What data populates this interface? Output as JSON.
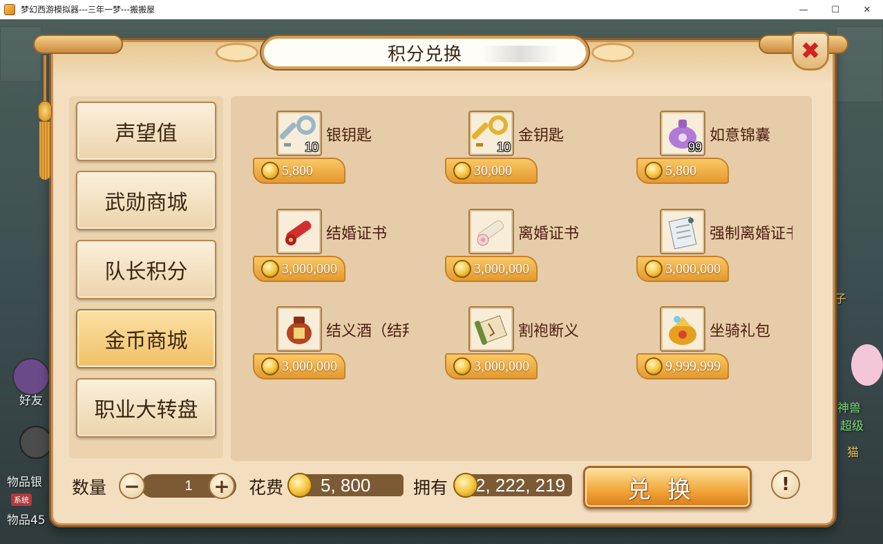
{
  "window": {
    "title": "梦幻西游模拟器---三年一梦---搬搬屋",
    "minimize": "—",
    "maximize": "☐",
    "close": "✕"
  },
  "background": {
    "left_texts": [
      "好友",
      "物品银",
      "物品45",
      "系统"
    ],
    "right_texts": [
      "子",
      "神兽",
      "超级",
      "猫"
    ]
  },
  "dialog": {
    "title": "积分兑换",
    "close_symbol": "✖"
  },
  "menu": {
    "items": [
      {
        "label": "声望值",
        "active": false
      },
      {
        "label": "武勋商城",
        "active": false
      },
      {
        "label": "队长积分",
        "active": false
      },
      {
        "label": "金币商城",
        "active": true
      },
      {
        "label": "职业大转盘",
        "active": false
      }
    ]
  },
  "items": [
    {
      "name": "银钥匙",
      "count": "10",
      "price": "5,800",
      "icon": "silver-key-icon"
    },
    {
      "name": "金钥匙",
      "count": "10",
      "price": "30,000",
      "icon": "gold-key-icon"
    },
    {
      "name": "如意锦囊",
      "count": "99",
      "price": "5,800",
      "icon": "brocade-pouch-icon"
    },
    {
      "name": "结婚证书",
      "count": "",
      "price": "3,000,000",
      "icon": "marriage-scroll-icon"
    },
    {
      "name": "离婚证书",
      "count": "",
      "price": "3,000,000",
      "icon": "divorce-scroll-icon"
    },
    {
      "name": "强制离婚证书",
      "count": "",
      "price": "3,000,000",
      "icon": "forced-divorce-paper-icon"
    },
    {
      "name": "结义酒（结拜）",
      "count": "",
      "price": "3,000,000",
      "icon": "wine-jar-icon"
    },
    {
      "name": "割袍断义",
      "count": "",
      "price": "3,000,000",
      "icon": "torn-scroll-icon"
    },
    {
      "name": "坐骑礼包",
      "count": "",
      "price": "9,999,999",
      "icon": "mount-giftbag-icon"
    }
  ],
  "bottom": {
    "qty_label": "数量",
    "qty_value": "1",
    "minus": "−",
    "plus": "+",
    "cost_label": "花费",
    "cost_value": "5, 800",
    "own_label": "拥有",
    "own_value": "2, 222, 219",
    "exchange_label": "兑换",
    "help": "!"
  },
  "colors": {
    "panel_bg": "#f3dfc0",
    "active_menu": "#f2c066",
    "price_tag": "#e49a2e",
    "close_x": "#d42121"
  }
}
